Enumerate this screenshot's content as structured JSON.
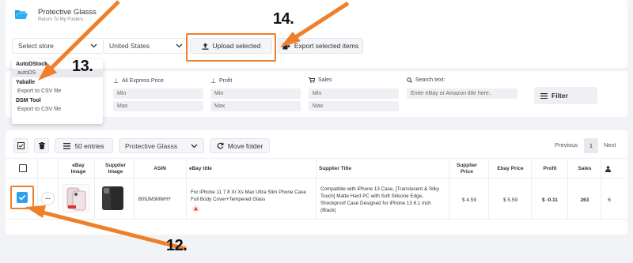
{
  "folder": {
    "title": "Protective Glasss",
    "subtitle": "Return To My Folders"
  },
  "toolbar": {
    "store_placeholder": "Select store",
    "country": "United States",
    "upload_label": "Upload selected",
    "export_label": "Export selected items"
  },
  "dropdown": {
    "groups": [
      {
        "name": "AutoDStock",
        "items": [
          "autoDS"
        ]
      },
      {
        "name": "Yaballe",
        "items": [
          "Export to CSV file"
        ]
      },
      {
        "name": "DSM Tool",
        "items": [
          "Export to CSV file"
        ]
      }
    ]
  },
  "filters": {
    "ali_price": "Ali Express Price",
    "profit": "Profit",
    "sales": "Sales",
    "search_label": "Search text:",
    "min": "Min",
    "max": "Max",
    "search_placeholder": "Enter eBay or Amazon title here..",
    "filter_label": "Filter"
  },
  "table_toolbar": {
    "entries": "50 entries",
    "folder": "Protective Glasss",
    "move_folder": "Move folder",
    "previous": "Previous",
    "page": "1",
    "next": "Next"
  },
  "table": {
    "headers": {
      "ebay_image": "eBay Image",
      "supplier_image": "Supplier Image",
      "asin": "ASIN",
      "ebay_title": "eBay title",
      "supplier_title": "Supplier Title",
      "supplier_price": "Supplier Price",
      "ebay_price": "Ebay Price",
      "profit": "Profit",
      "sales": "Sales"
    },
    "rows": [
      {
        "asin": "B09JM3MWHY",
        "ebay_title": "For iPhone 11 7 8 Xr Xs Max Ultra Slim Phone Case Full Body Cover+Tempered Glass",
        "supplier_title": "Compatible with iPhone 13 Case, [Translucent & Silky Touch] Matte Hard PC with Soft Silicone Edge, Shockproof Case Designed for iPhone 13 6.1 inch (Black)",
        "supplier_price": "$ 4.59",
        "ebay_price": "$ 5.59",
        "profit": "$ -0.11",
        "sales": "263",
        "extra": "6",
        "more": "..."
      }
    ]
  },
  "annotations": {
    "n12": "12.",
    "n13": "13.",
    "n14": "14."
  },
  "colors": {
    "accent": "#f07f2a",
    "checkbox": "#2f9ff0",
    "folder": "#1c9de6"
  }
}
